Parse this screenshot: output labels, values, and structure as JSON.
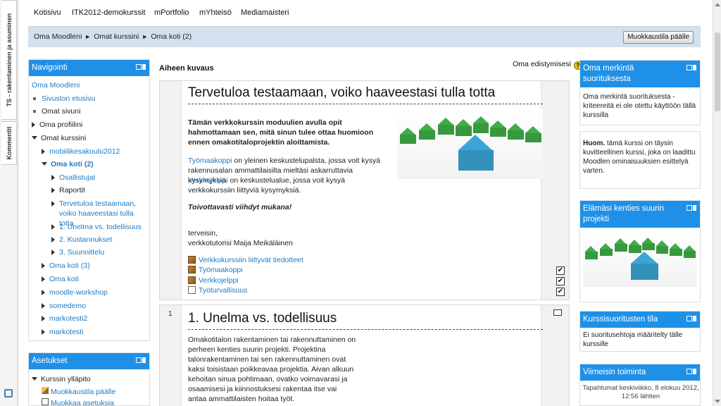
{
  "side_tabs": [
    "TS - rakentaminen ja asuminen",
    "Kommentit"
  ],
  "topnav": [
    "Kotisivu",
    "ITK2012-demokurssit",
    "mPortfolio",
    "mYhteisö",
    "Mediamaisteri"
  ],
  "breadcrumb": [
    "Oma Moodleni",
    "Omat kurssini",
    "Oma koti (2)"
  ],
  "edit_button": "Muokkaustila päälle",
  "navigation": {
    "title": "Navigointi",
    "items": [
      {
        "label": "Oma Moodleni",
        "link": true
      },
      {
        "label": "Sivuston etusivu",
        "link": true
      },
      {
        "label": "Omat sivuni",
        "link": false
      },
      {
        "label": "Oma profiilini",
        "link": false
      },
      {
        "label": "Omat kurssini",
        "link": false
      },
      {
        "label": "mobiilikesakoulu2012",
        "link": true
      },
      {
        "label": "Oma koti (2)",
        "link": true
      },
      {
        "label": "Osallistujat",
        "link": true
      },
      {
        "label": "Raportit",
        "link": false
      },
      {
        "label": "Tervetuloa testaamaan, voiko haaveestasi tulla totta",
        "link": true
      },
      {
        "label": "1. Unelma vs. todellisuus",
        "link": true
      },
      {
        "label": "2. Kustannukset",
        "link": true
      },
      {
        "label": "3. Suunnittelu",
        "link": true
      },
      {
        "label": "Oma koti (3)",
        "link": true
      },
      {
        "label": "Oma koti",
        "link": true
      },
      {
        "label": "moodle-workshop",
        "link": true
      },
      {
        "label": "somedemo",
        "link": true
      },
      {
        "label": "markotesti2",
        "link": true
      },
      {
        "label": "markotesti",
        "link": true
      }
    ]
  },
  "settings": {
    "title": "Asetukset",
    "items": [
      "Kurssin ylläpito",
      "Muokkaustila päälle",
      "Muokkaa asetuksia"
    ]
  },
  "main": {
    "heading": "Aiheen kuvaus",
    "progress_label": "Oma edistymisesi",
    "section0": {
      "title": "Tervetuloa testaamaan, voiko haaveestasi tulla totta",
      "intro": "Tämän verkkokurssin moduulien avulla opit hahmottamaan sen, mitä sinun tulee ottaa huomioon ennen omakotitaloprojektin aloittamista.",
      "para1_link": "Työmaakoppi",
      "para1_rest": " on yleinen keskustelupalsta, jossa voit kysyä rakennusalan ammattilaisilta mieltäsi askarruttavia kysymyksiä.",
      "para2_link": "Verkkojelppi",
      "para2_rest": " on keskustelualue, jossa voit kysyä verkkokurssiin liittyviä kysymyksiä.",
      "wish": "Toivottavasti viihdyt mukana!",
      "greet1": "terveisin,",
      "greet2": "verkkotutorisi Maija Meikäläinen",
      "activities": [
        "Verkkokurssiin liittyvät tiedotteet",
        "Työmaakoppi",
        "Verkkojelppi",
        "Työturvallisuus"
      ]
    },
    "section1": {
      "number": "1",
      "title": "1. Unelma vs. todellisuus",
      "text": "Omakotitalon rakentaminen tai rakennuttaminen on perheen kenties suurin projekti. Projektina talonrakentaminen tai sen rakennuttaminen ovat kaksi toisistaan poikkeavaa projektia. Aivan alkuun kehoitan sinua pohtimaan, ovatko voimavarasi ja osaamisesi ja kiinnostuksesi rakentaa itse vai antaa ammattilaisten hoitaa työt."
    }
  },
  "right": {
    "badge": {
      "title": "Oma merkintä suorituksesta",
      "text": "Oma merkintä suorituksesta -kriteereitä ei ole otettu käyttöön tällä kurssilla"
    },
    "note": {
      "bold": "Huom.",
      "text": " tämä kurssi on täysin kuvitteellinen kurssi, joka on laadittu Moodlen ominaisuuksien esittelyä varten."
    },
    "project": {
      "title": "Elämäsi kenties suurin projekti"
    },
    "completion": {
      "title": "Kurssisuoritusten tila",
      "text": "Ei suoritusehtoja määritelty tälle kurssille"
    },
    "recent": {
      "title": "Viimeisin toiminta",
      "text": "Tapahtumat keskiviikko, 8 elokuu 2012, 12:56 lähtien"
    }
  },
  "colors": {
    "block_header": "#1e90e8",
    "link": "#1a7ac8",
    "breadcrumb_bg": "#d4e0ee",
    "house_green": "#3fae47",
    "house_blue": "#3aa6d6"
  }
}
